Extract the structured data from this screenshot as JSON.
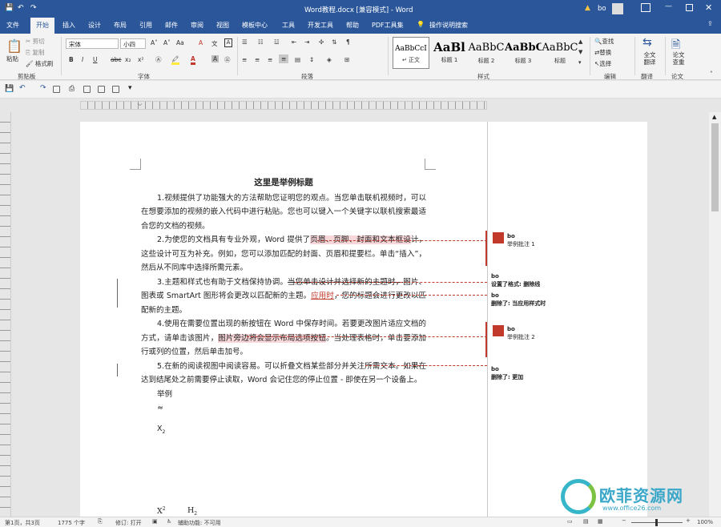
{
  "window": {
    "title": "Word教程.docx [兼容模式] - Word",
    "warning": "▲",
    "user": "bo"
  },
  "tabs": [
    "文件",
    "开始",
    "插入",
    "设计",
    "布局",
    "引用",
    "邮件",
    "审阅",
    "视图",
    "模板中心",
    "工具",
    "开发工具",
    "帮助",
    "PDF工具集",
    "操作说明搜索"
  ],
  "clipboard": {
    "paste": "粘贴",
    "cut": "剪切",
    "copy": "复制",
    "format_painter": "格式刷",
    "group": "剪贴板"
  },
  "font": {
    "name": "宋体",
    "size": "小四",
    "group": "字体",
    "grow": "A˄",
    "shrink": "A˅",
    "case": "Aa",
    "clear": "A",
    "wen": "文",
    "bold": "B",
    "italic": "I",
    "underline": "U",
    "strike": "abc",
    "sub": "x₂",
    "sup": "x²",
    "color": "A"
  },
  "paragraph": {
    "group": "段落"
  },
  "styles": {
    "group": "样式",
    "items": [
      {
        "sample": "AaBbCcI",
        "label": "↵ 正文"
      },
      {
        "sample": "AaBl",
        "label": "标题 1"
      },
      {
        "sample": "AaBbC",
        "label": "标题 2"
      },
      {
        "sample": "AaBbC",
        "label": "标题 3"
      },
      {
        "sample": "AaBbC",
        "label": "标题"
      }
    ]
  },
  "editing": {
    "group": "编辑",
    "find": "查找",
    "replace": "替换",
    "select": "选择"
  },
  "translate": {
    "label": "全文翻译",
    "group": "翻译"
  },
  "paper": {
    "label": "论文查重",
    "group": "论文"
  },
  "document": {
    "title": "这里是举例标题",
    "p1": "1.视频提供了功能强大的方法帮助您证明您的观点。当您单击联机视频时，可以在想要添加的视频的嵌入代码中进行粘贴。您也可以键入一个关键字以联机搜索最适合您的文档的视频。",
    "p2a": "2.为使您的文档具有专业外观，Word 提供了",
    "p2b": "页眉、页脚、封面和文本框设",
    "p2c": "计，这些设计可互为补充。例如，您可以添加匹配的封面、页眉和提要栏。单击“插入”，然后从不同库中选择所需元素。",
    "p3a": "3.主题和样式也有助于文档保持协调。",
    "p3b": "当您单击设计并选择新的主题时，",
    "p3c": "图片、图表或 SmartArt 图形将会更改以匹配新的主题。",
    "p3d": "应用时",
    "p3e": "，您的标题会进行更改以匹配新的主题。",
    "p4a": "4.使用在需要位置出现的新按钮在 Word 中保存时间。若要更改图片适应文档的方式，请单击该图片，",
    "p4b": "图片旁边将会显示布局选项按钮",
    "p4c": "。当处理表格时，单击要添加行或列的位置，然后单击加号。",
    "p5": "5.在新的阅读视图中阅读容易。可以折叠文档某些部分并关注所需文本。如果在达到结尾处之前需要停止读取，Word 会记住您的停止位置 - 即使在另一个设备上。",
    "example": "举例",
    "symbol1": "≈",
    "symbol2": "X",
    "symbol2_sub": "2",
    "symbol3": "X",
    "symbol3_sup": "2",
    "symbol4": "H",
    "symbol4_sub": "2"
  },
  "comments": [
    {
      "author": "bo",
      "text": "举例批注 1"
    },
    {
      "author": "bo",
      "text": "设置了格式: 删除线"
    },
    {
      "author": "bo",
      "text": "删除了: 当应用样式时"
    },
    {
      "author": "bo",
      "text": "举例批注 2"
    },
    {
      "author": "bo",
      "text": "删除了: 更加"
    }
  ],
  "status": {
    "page": "第1页，共3页",
    "words": "1775 个字",
    "track": "修订: 打开",
    "access": "辅助功能: 不可用",
    "zoom": "100%"
  },
  "watermark": {
    "text": "欧菲资源网",
    "url": "www.office26.com"
  },
  "colors": {
    "brand": "#2b579a",
    "revision": "#c0392b"
  }
}
